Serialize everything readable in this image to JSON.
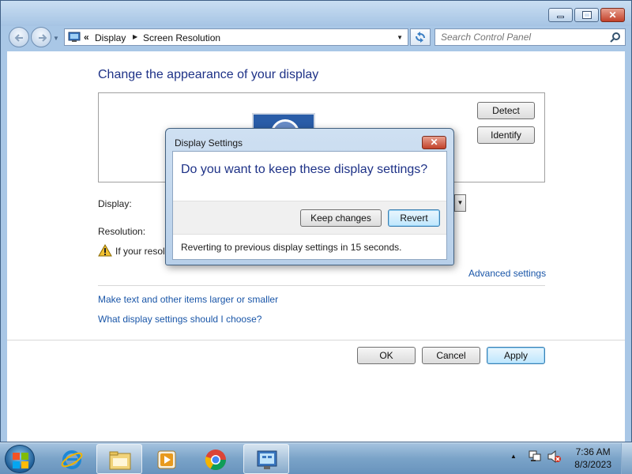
{
  "window": {
    "breadcrumb_chevron": "«",
    "breadcrumb": [
      "Display",
      "Screen Resolution"
    ],
    "search_placeholder": "Search Control Panel"
  },
  "main": {
    "heading": "Change the appearance of your display",
    "detect_label": "Detect",
    "identify_label": "Identify",
    "display_label": "Display:",
    "resolution_label": "Resolution:",
    "warning_text": "If your resolu",
    "advanced_link": "Advanced settings",
    "link_text_size": "Make text and other items larger or smaller",
    "link_help": "What display settings should I choose?",
    "ok_label": "OK",
    "cancel_label": "Cancel",
    "apply_label": "Apply"
  },
  "dialog": {
    "title": "Display Settings",
    "question": "Do you want to keep these display settings?",
    "keep_label": "Keep changes",
    "revert_label": "Revert",
    "countdown_text": "Reverting to previous display settings in 15 seconds."
  },
  "taskbar": {
    "apps": [
      "internet-explorer",
      "windows-explorer",
      "media-player",
      "chrome",
      "control-panel"
    ],
    "active_app": "control-panel",
    "time": "7:36 AM",
    "date": "8/3/2023"
  },
  "colors": {
    "heading": "#1e3287",
    "link": "#1a56a8",
    "window_frame": "#a9c7e6",
    "close_button": "#c2412a"
  }
}
